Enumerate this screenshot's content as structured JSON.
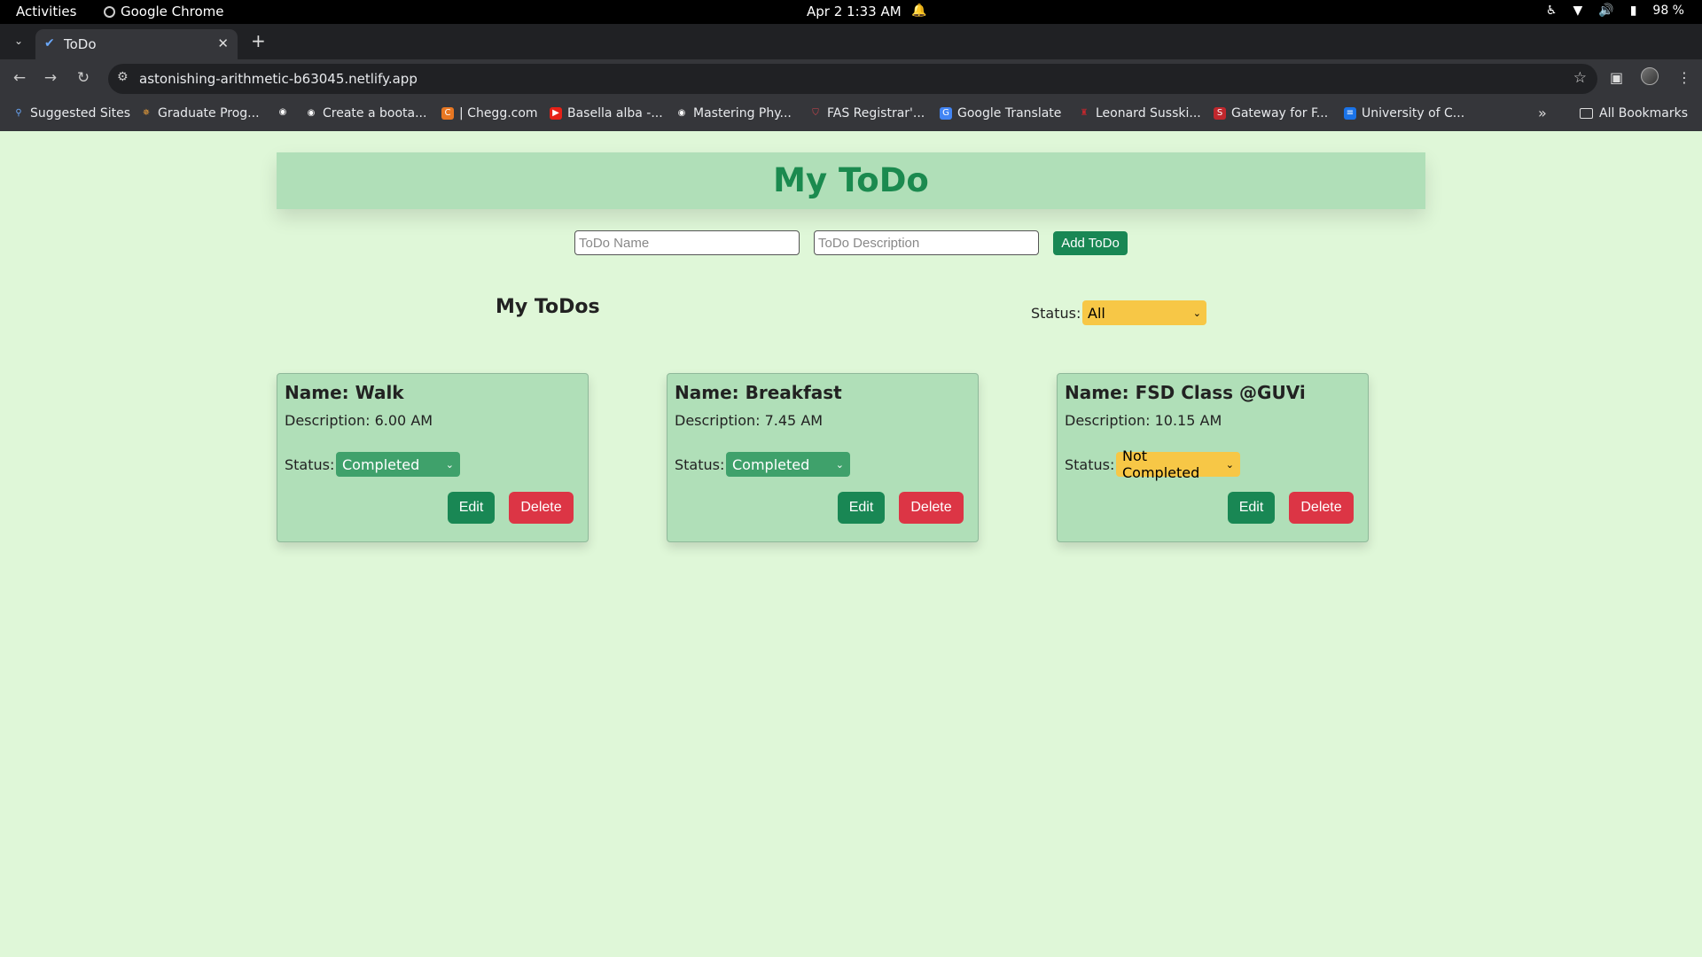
{
  "os": {
    "activities": "Activities",
    "app_name": "Google Chrome",
    "clock": "Apr 2  1:33 AM",
    "battery": "98 %"
  },
  "browser": {
    "tab_title": "ToDo",
    "url": "astonishing-arithmetic-b63045.netlify.app",
    "bookmarks": [
      "Suggested Sites",
      "Graduate Prog...",
      "Create a boota...",
      "| Chegg.com",
      "Basella alba -...",
      "Mastering Phy...",
      "FAS Registrar'...",
      "Google Translate",
      "Leonard Susski...",
      "Gateway for F...",
      "University of C..."
    ],
    "all_bookmarks": "All Bookmarks"
  },
  "app": {
    "title": "My ToDo",
    "name_placeholder": "ToDo Name",
    "desc_placeholder": "ToDo Description",
    "add_button": "Add ToDo",
    "list_title": "My ToDos",
    "filter_label": "Status:",
    "filter_value": "All",
    "status_label": "Status:",
    "edit_label": "Edit",
    "delete_label": "Delete",
    "todos": [
      {
        "name": "Name: Walk",
        "description": "Description: 6.00 AM",
        "status": "Completed"
      },
      {
        "name": "Name: Breakfast",
        "description": "Description: 7.45 AM",
        "status": "Completed"
      },
      {
        "name": "Name: FSD Class @GUVi",
        "description": "Description: 10.15 AM",
        "status": "Not Completed"
      }
    ]
  },
  "colors": {
    "page_bg": "#dff7d8",
    "header_bg": "#b0dfb8",
    "title_green": "#1b8a4f",
    "button_green": "#198754",
    "button_red": "#dc3545",
    "select_yellow": "#f7c746",
    "select_green": "#3fa16b"
  }
}
